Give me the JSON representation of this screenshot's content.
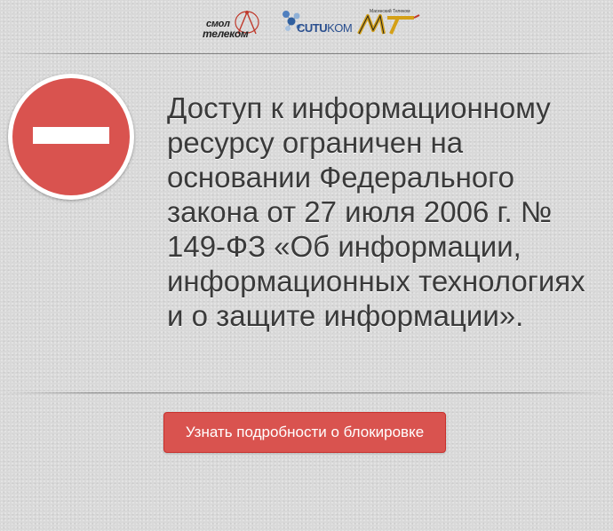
{
  "logos": {
    "smoltelecom": {
      "line1": "смол",
      "line2": "телеком",
      "icon": "smoltelecom-logo-icon"
    },
    "cutikom": {
      "prefix": "CUTU",
      "suffix": "KOM",
      "icon": "cutikom-logo-icon"
    },
    "mt": {
      "caption": "Магинский Телеком",
      "icon": "mt-logo-icon"
    }
  },
  "stop_sign": {
    "icon": "no-entry-icon",
    "color": "#d9534f"
  },
  "message": "Доступ к информационному ресурсу ограничен на основании Федерального закона от 27 июля 2006 г. № 149-ФЗ «Об информации, информационных технологиях и о защите информации».",
  "details_button": {
    "label": "Узнать подробности о блокировке",
    "color": "#d9534f"
  }
}
